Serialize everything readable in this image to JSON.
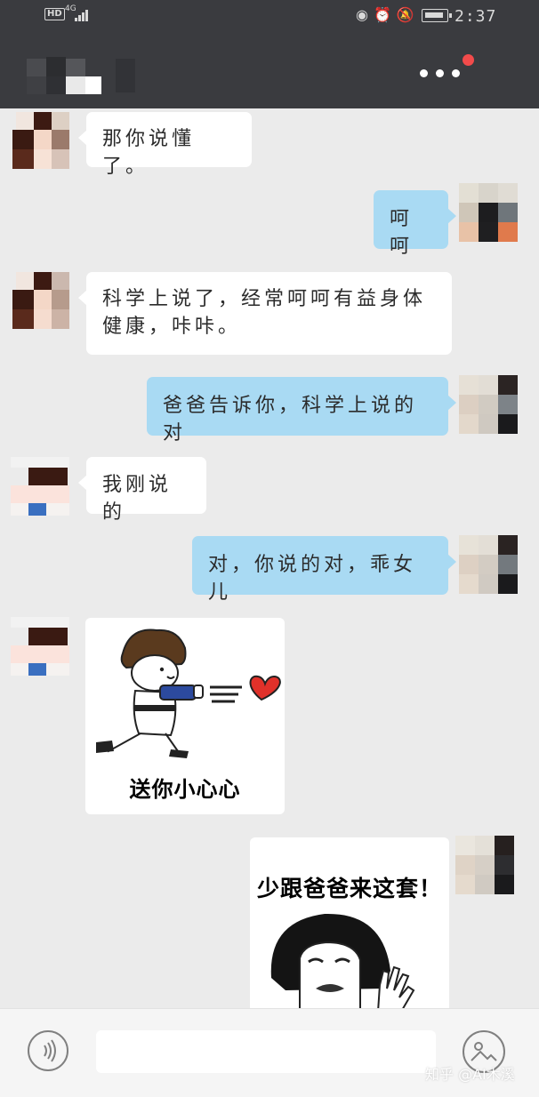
{
  "status_bar": {
    "hd": "HD",
    "network": "4G",
    "time": "2:37"
  },
  "header": {
    "more_icon": "more-dots-icon",
    "has_notification": true
  },
  "messages": [
    {
      "side": "in",
      "type": "text",
      "text": "那你说懂了。"
    },
    {
      "side": "out",
      "type": "text",
      "text": "呵呵"
    },
    {
      "side": "in",
      "type": "text",
      "line1": "科学上说了，经常呵呵有益身体",
      "line2": "健康，咔咔。"
    },
    {
      "side": "out",
      "type": "text",
      "text": "爸爸告诉你，科学上说的对"
    },
    {
      "side": "in",
      "type": "text",
      "text": "我刚说的"
    },
    {
      "side": "out",
      "type": "text",
      "text": "对，你说的对，乖女儿"
    },
    {
      "side": "in",
      "type": "sticker",
      "caption": "送你小心心"
    },
    {
      "side": "out",
      "type": "sticker",
      "caption": "少跟爸爸来这套！"
    }
  ],
  "input_bar": {
    "voice_icon": "voice-icon",
    "image_icon": "image-icon",
    "watermark": "知乎 @AI木溪"
  },
  "colors": {
    "header_bg": "#3a3b3f",
    "chat_bg": "#ebebeb",
    "outgoing_bubble": "#a9daf3",
    "incoming_bubble": "#ffffff",
    "notification_dot": "#f24b4b"
  }
}
